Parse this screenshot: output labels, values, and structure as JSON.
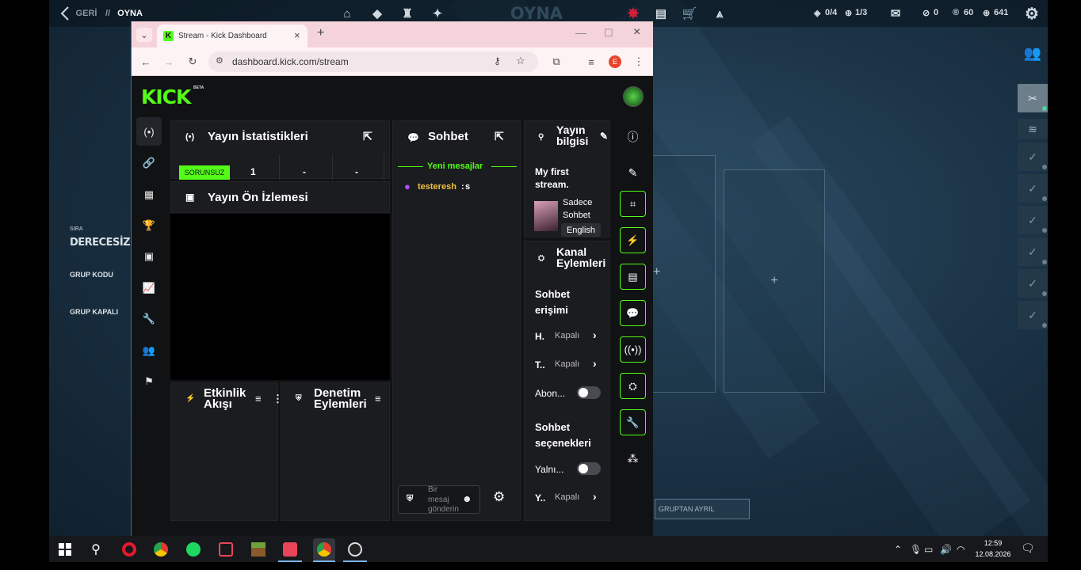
{
  "game": {
    "back_label": "GERİ",
    "separator": "//",
    "section_label": "OYNA",
    "center_title": "OYNA",
    "stats": {
      "missions": "0/4",
      "level": "1/3",
      "vp": "0",
      "radianite": "60",
      "kingdom": "641"
    },
    "left_panel": {
      "rank_caption": "SIRA",
      "rank_value": "DERECESİZ",
      "group_code": "GRUP KODU",
      "group_status": "GRUP KAPALI"
    },
    "leave_group": "GRUPTAN AYRIL",
    "card_plus": "+"
  },
  "browser": {
    "tab_title": "Stream - Kick Dashboard",
    "url": "dashboard.kick.com/stream",
    "profile_initial": "E"
  },
  "kick": {
    "logo": "KICK",
    "beta": "BETA",
    "stats_panel": {
      "title": "Yayın İstatistikleri",
      "status_badge": "SORUNSUZ",
      "cells": [
        "1",
        "-",
        "-"
      ]
    },
    "preview_panel": {
      "title": "Yayın Ön İzlemesi"
    },
    "activity_panel": {
      "title_line1": "Etkinlik",
      "title_line2": "Akışı"
    },
    "mod_panel": {
      "title_line1": "Denetim",
      "title_line2": "Eylemleri"
    },
    "chat_panel": {
      "title": "Sohbet",
      "new_messages": "Yeni mesajlar",
      "message_user": "testeresh",
      "message_text": "s",
      "input_placeholder_1": "Bir",
      "input_placeholder_2": "mesaj",
      "input_placeholder_3": "gönderin"
    },
    "stream_info": {
      "title_line1": "Yayın",
      "title_line2": "bilgisi",
      "stream_title_1": "My first",
      "stream_title_2": "stream.",
      "category_1": "Sadece",
      "category_2": "Sohbet",
      "language": "English"
    },
    "channel_actions": {
      "title_line1": "Kanal",
      "title_line2": "Eylemleri",
      "chat_access_1": "Sohbet",
      "chat_access_2": "erişimi",
      "row1_label": "H.",
      "row1_value": "Kapalı",
      "row2_label": "T..",
      "row2_value": "Kapalı",
      "row3_label": "Abon...",
      "chat_options_1": "Sohbet",
      "chat_options_2": "seçenekleri",
      "row4_label": "Yalnı...",
      "row5_label": "Y..",
      "row5_value": "Kapalı"
    }
  },
  "taskbar": {
    "time": "12:59",
    "date": "12.08.2026"
  },
  "colors": {
    "kick_green": "#53fc18",
    "tab_pink": "#f5d3da",
    "panel_bg": "#1b1c1f"
  }
}
